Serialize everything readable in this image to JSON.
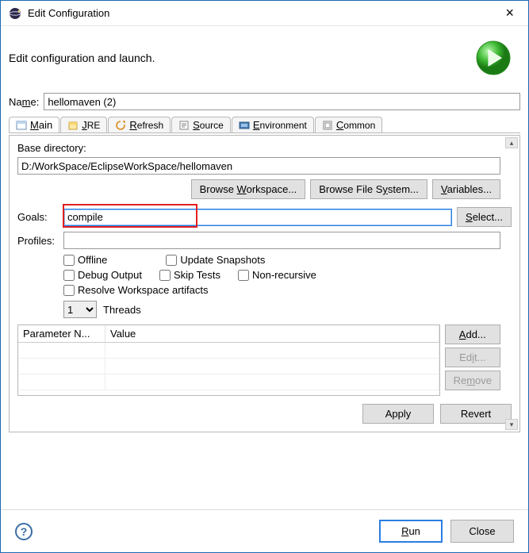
{
  "window": {
    "title": "Edit Configuration",
    "subtitle": "Edit configuration and launch."
  },
  "name": {
    "label": "Name:",
    "underline": "m",
    "value": "hellomaven (2)"
  },
  "tabs": {
    "main": "Main",
    "main_u": "M",
    "jre": "JRE",
    "jre_u": "J",
    "refresh": "Refresh",
    "refresh_u": "R",
    "source": "Source",
    "source_u": "S",
    "environment": "Environment",
    "environment_u": "E",
    "common": "Common",
    "common_u": "C"
  },
  "main": {
    "base_dir_label": "Base directory:",
    "base_dir_value": "D:/WorkSpace/EclipseWorkSpace/hellomaven",
    "browse_workspace": "Browse Workspace...",
    "browse_workspace_u": "W",
    "browse_filesystem": "Browse File System...",
    "browse_filesystem_u": "y",
    "variables": "Variables...",
    "variables_u": "V",
    "goals_label": "Goals:",
    "goals_u": "G",
    "goals_value": "compile",
    "select": "Select...",
    "select_u": "S",
    "profiles_label": "Profiles:",
    "profiles_u": "P",
    "profiles_value": "",
    "offline": "Offline",
    "offline_u": "O",
    "update_snapshots": "Update Snapshots",
    "update_snapshots_u": "U",
    "debug_output": "Debug Output",
    "debug_output_u": "D",
    "skip_tests": "Skip Tests",
    "skip_tests_u": "S",
    "non_recursive": "Non-recursive",
    "resolve_ws": "Resolve Workspace artifacts",
    "threads_label": "Threads",
    "threads_u": "T",
    "threads_value": "1",
    "col_param": "Parameter N...",
    "col_value": "Value",
    "add": "Add...",
    "add_u": "A",
    "edit": "Edit...",
    "edit_u": "i",
    "remove": "Remove",
    "remove_u": "m",
    "apply": "Apply",
    "revert": "Revert"
  },
  "footer": {
    "run": "Run",
    "run_u": "R",
    "close": "Close"
  }
}
